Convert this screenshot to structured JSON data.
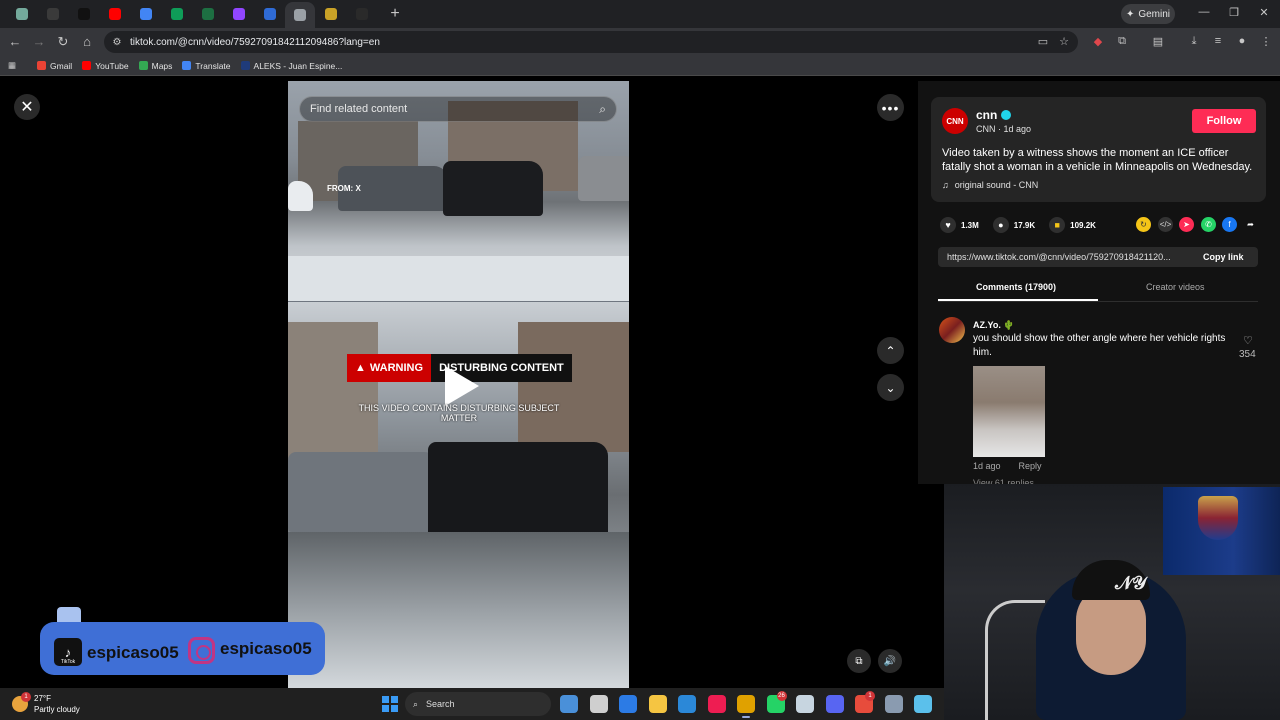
{
  "browser": {
    "tabs": [
      {
        "icon": "chatgpt-icon",
        "color": "#74aa9c"
      },
      {
        "icon": "tab-icon",
        "color": "#3a3a3a"
      },
      {
        "icon": "tiktok-icon",
        "color": "#111111"
      },
      {
        "icon": "youtube-icon",
        "color": "#ff0000"
      },
      {
        "icon": "docs-icon",
        "color": "#4285f4"
      },
      {
        "icon": "sheets-icon",
        "color": "#0f9d58"
      },
      {
        "icon": "excel-icon",
        "color": "#1d6f42"
      },
      {
        "icon": "twitch-icon",
        "color": "#9146ff"
      },
      {
        "icon": "aleks-icon",
        "color": "#2f6bd6"
      },
      {
        "icon": "audio-playing-icon",
        "color": "#9aa0a6",
        "active": true
      },
      {
        "icon": "tab-icon",
        "color": "#c9a227"
      },
      {
        "icon": "tab-icon",
        "color": "#2a2a2a"
      }
    ],
    "new_tab": "+",
    "gemini_label": "Gemini",
    "url": "tiktok.com/@cnn/video/7592709184211209486?lang=en",
    "bookmarks": [
      {
        "label": "Gmail",
        "icon": "gmail-icon",
        "color": "#ea4335"
      },
      {
        "label": "YouTube",
        "icon": "youtube-icon",
        "color": "#ff0000"
      },
      {
        "label": "Maps",
        "icon": "maps-icon",
        "color": "#34a853"
      },
      {
        "label": "Translate",
        "icon": "translate-icon",
        "color": "#4285f4"
      },
      {
        "label": "ALEKS - Juan Espine...",
        "icon": "aleks-icon",
        "color": "#1f3b7a"
      }
    ]
  },
  "video": {
    "search_placeholder": "Find related content",
    "from_label": "FROM: X",
    "warning_label": "WARNING",
    "warning_title": "DISTURBING CONTENT",
    "warning_sub": "THIS VIDEO CONTAINS DISTURBING SUBJECT MATTER"
  },
  "post": {
    "username": "cnn",
    "avatar_text": "CNN",
    "subline": "CNN · 1d ago",
    "follow_label": "Follow",
    "description": "Video taken by a witness shows the moment an ICE officer fatally shot a woman in a vehicle in Minneapolis on Wednesday.",
    "sound": "original sound - CNN",
    "likes": "1.3M",
    "comments_count": "17.9K",
    "saves": "109.2K",
    "share_url": "https://www.tiktok.com/@cnn/video/759270918421120...",
    "copy_link_label": "Copy link",
    "tab_comments": "Comments (17900)",
    "tab_creator": "Creator videos"
  },
  "comment": {
    "user": "AZ.Yo.",
    "user_emoji": "🌵",
    "text": "you should show the other angle where her vehicle rights him.",
    "likes": "354",
    "time": "1d ago",
    "reply_label": "Reply",
    "replies": "View 61 replies"
  },
  "overlay": {
    "tiktok_label": "TikTok",
    "tiktok_handle": "espicaso05",
    "instagram_handle": "espicaso05"
  },
  "taskbar": {
    "temperature": "27°F",
    "condition": "Partly cloudy",
    "weather_badge": "1",
    "search_label": "Search",
    "apps": [
      {
        "icon": "copilot-icon",
        "color": "#4a90d9"
      },
      {
        "icon": "task-view-icon",
        "color": "#cfcfcf"
      },
      {
        "icon": "m365-icon",
        "color": "#2c7be5"
      },
      {
        "icon": "file-explorer-icon",
        "color": "#f5c542"
      },
      {
        "icon": "store-icon",
        "color": "#2b88d8"
      },
      {
        "icon": "tiktok-icon",
        "color": "#ee1d52"
      },
      {
        "icon": "chrome-icon",
        "color": "#e0a100",
        "active": true
      },
      {
        "icon": "whatsapp-icon",
        "color": "#25d366",
        "badge": "26"
      },
      {
        "icon": "steam-icon",
        "color": "#c7d5e0"
      },
      {
        "icon": "discord-icon",
        "color": "#5865f2"
      },
      {
        "icon": "app-icon",
        "color": "#e74c3c",
        "badge": "1"
      },
      {
        "icon": "settings-icon",
        "color": "#8a9bb0"
      },
      {
        "icon": "notepad-icon",
        "color": "#5bc0eb"
      }
    ]
  }
}
